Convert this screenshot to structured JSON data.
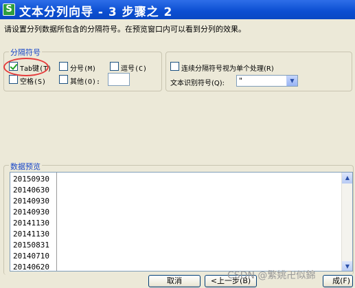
{
  "window": {
    "title": "文本分列向导 - 3 步骤之 2",
    "app_icon_letter": "S"
  },
  "description": "请设置分列数据所包含的分隔符号。在预览窗口内可以看到分列的效果。",
  "delimiters": {
    "legend": "分隔符号",
    "tab_label": "Tab键(T)",
    "tab_checked": true,
    "semicolon_label": "分号(M)",
    "comma_label": "逗号(C)",
    "space_label": "空格(S)",
    "other_label": "其他(O):",
    "other_value": ""
  },
  "options": {
    "consecutive_label": "连续分隔符号视为单个处理(R)",
    "qualifier_label": "文本识别符号(Q):",
    "qualifier_value": "\""
  },
  "preview": {
    "legend": "数据预览",
    "rows": [
      "20150930",
      "20140630",
      "20140930",
      "20140930",
      "20141130",
      "20141130",
      "20150831",
      "20140710",
      "20140620"
    ]
  },
  "buttons": {
    "cancel": "取消",
    "back": "<上一步(B)",
    "finish": "成(F)"
  },
  "watermark": "CSDN @繁姚卍似錦",
  "colors": {
    "titlebar": "#0b4ed1",
    "legend_text": "#1846c8",
    "annotation": "#e53b3b"
  }
}
